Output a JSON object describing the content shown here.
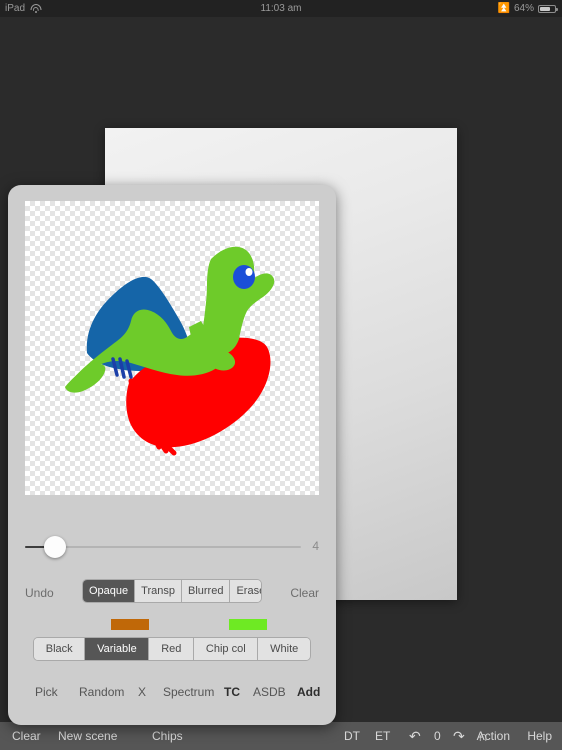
{
  "status_bar": {
    "device": "iPad",
    "wifi_icon": "wifi-icon",
    "time": "11:03 am",
    "bluetooth_icon": "bluetooth-icon",
    "battery_percent": "64%",
    "battery_icon": "battery-icon"
  },
  "paint_panel": {
    "canvas": {
      "name": "drawing-canvas",
      "background": "transparency-checkerboard",
      "artwork": {
        "description": "bird drawing",
        "colors": {
          "green": "#6ECB2A",
          "blue": "#1565A8",
          "red": "#FF0000",
          "eye_blue": "#1B4FD8",
          "eye_highlight": "#FFFFFF"
        }
      }
    },
    "size_slider": {
      "name": "brush-size-slider",
      "value": "4",
      "percent": 11
    },
    "tool_row": {
      "undo_label": "Undo",
      "clear_label": "Clear",
      "modes": [
        {
          "label": "Opaque",
          "selected": true
        },
        {
          "label": "Transp",
          "selected": false
        },
        {
          "label": "Blurred",
          "selected": false
        },
        {
          "label": "Erase",
          "selected": false
        }
      ]
    },
    "swatches": {
      "variable_color": "#C06808",
      "chip_color": "#6EEA23"
    },
    "color_row": {
      "options": [
        {
          "label": "Black",
          "selected": false
        },
        {
          "label": "Variable",
          "selected": true
        },
        {
          "label": "Red",
          "selected": false
        },
        {
          "label": "Chip col",
          "selected": false
        },
        {
          "label": "White",
          "selected": false
        }
      ]
    },
    "actions": [
      {
        "label": "Pick",
        "bold": false
      },
      {
        "label": "Random",
        "bold": false
      },
      {
        "label": "X",
        "bold": false
      },
      {
        "label": "Spectrum",
        "bold": false
      },
      {
        "label": "TC",
        "bold": true
      },
      {
        "label": "ASDB",
        "bold": false
      },
      {
        "label": "Add",
        "bold": true
      }
    ]
  },
  "bottom_toolbar": {
    "clear": "Clear",
    "new_scene": "New scene",
    "chips": "Chips",
    "dt": "DT",
    "et": "ET",
    "undo_icon": "undo-arrow-icon",
    "counter": "0",
    "redo_icon": "redo-arrow-icon",
    "magnet_icon": "magnet-icon",
    "action": "Action",
    "help": "Help"
  }
}
